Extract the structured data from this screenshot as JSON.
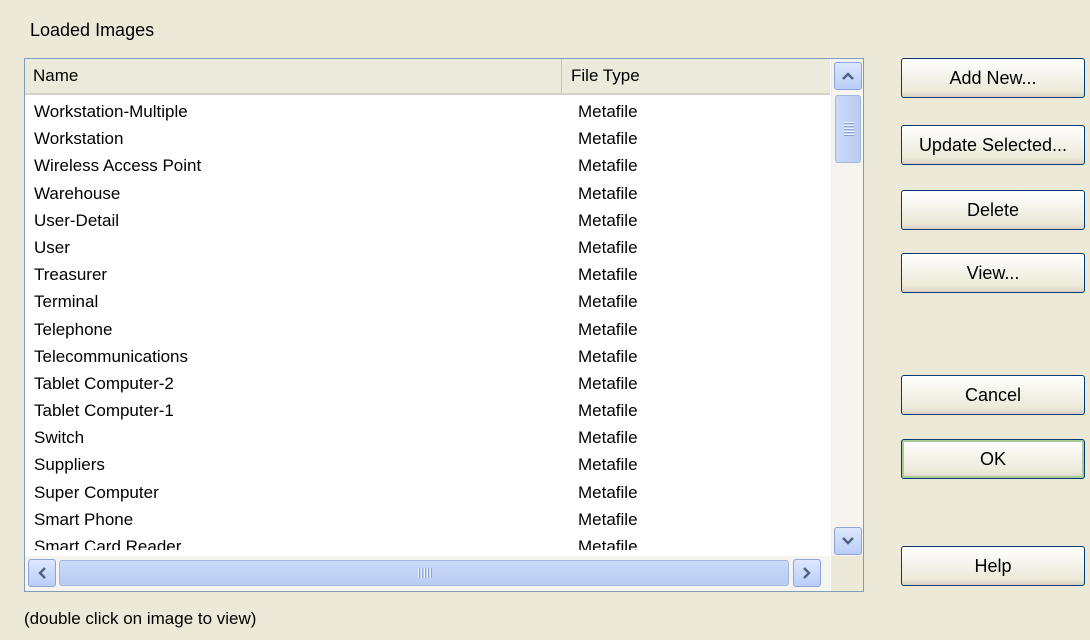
{
  "group_label": "Loaded Images",
  "columns": {
    "name": "Name",
    "type": "File Type"
  },
  "rows": [
    {
      "name": "Workstation-Multiple",
      "type": "Metafile"
    },
    {
      "name": "Workstation",
      "type": "Metafile"
    },
    {
      "name": "Wireless Access Point",
      "type": "Metafile"
    },
    {
      "name": "Warehouse",
      "type": "Metafile"
    },
    {
      "name": "User-Detail",
      "type": "Metafile"
    },
    {
      "name": "User",
      "type": "Metafile"
    },
    {
      "name": "Treasurer",
      "type": "Metafile"
    },
    {
      "name": "Terminal",
      "type": "Metafile"
    },
    {
      "name": "Telephone",
      "type": "Metafile"
    },
    {
      "name": "Telecommunications",
      "type": "Metafile"
    },
    {
      "name": "Tablet Computer-2",
      "type": "Metafile"
    },
    {
      "name": "Tablet Computer-1",
      "type": "Metafile"
    },
    {
      "name": "Switch",
      "type": "Metafile"
    },
    {
      "name": "Suppliers",
      "type": "Metafile"
    },
    {
      "name": "Super Computer",
      "type": "Metafile"
    },
    {
      "name": "Smart Phone",
      "type": "Metafile"
    },
    {
      "name": "Smart Card Reader",
      "type": "Metafile"
    }
  ],
  "buttons": {
    "add_new": "Add New...",
    "update_selected": "Update Selected...",
    "delete": "Delete",
    "view": "View...",
    "cancel": "Cancel",
    "ok": "OK",
    "help": "Help"
  },
  "icons": {
    "scroll_up": "chevron-up-icon",
    "scroll_down": "chevron-down-icon",
    "scroll_left": "chevron-left-icon",
    "scroll_right": "chevron-right-icon"
  },
  "hint": "(double click on image to view)"
}
